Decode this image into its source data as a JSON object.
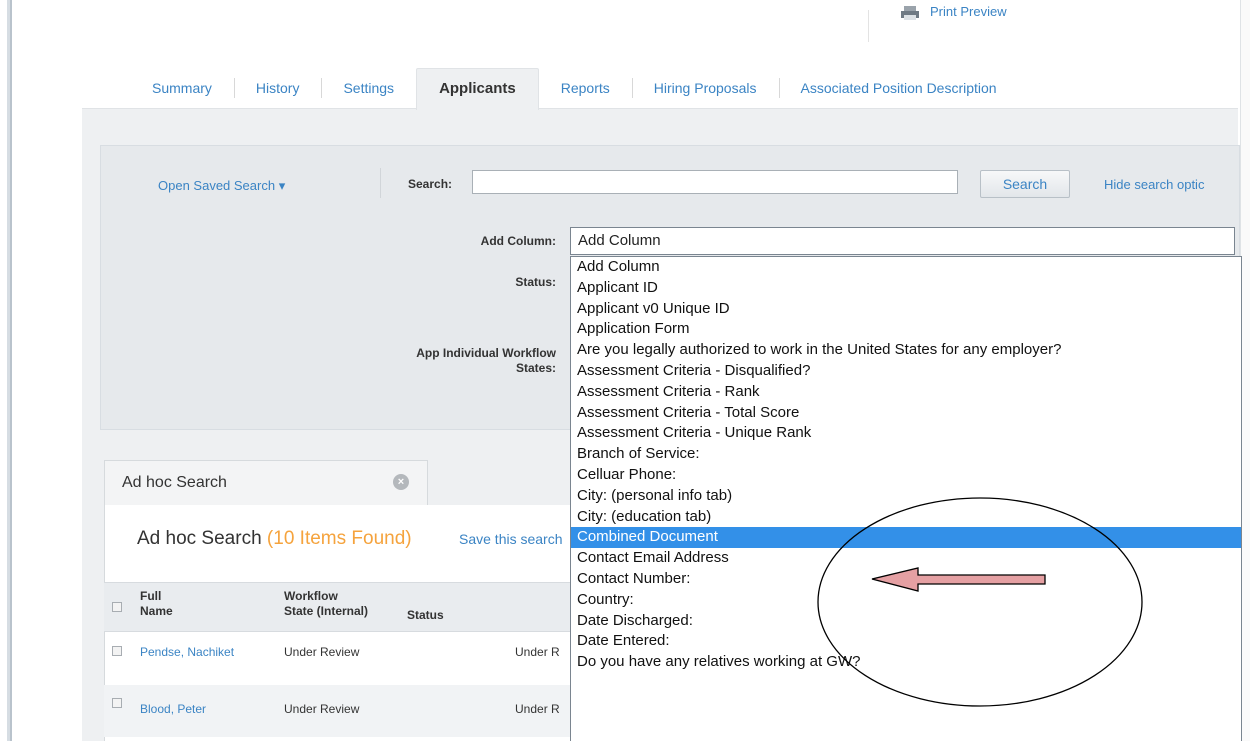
{
  "header": {
    "print_preview": "Print Preview"
  },
  "tabs": [
    {
      "label": "Summary"
    },
    {
      "label": "History"
    },
    {
      "label": "Settings"
    },
    {
      "label": "Applicants",
      "active": true
    },
    {
      "label": "Reports"
    },
    {
      "label": "Hiring Proposals"
    },
    {
      "label": "Associated Position Description"
    }
  ],
  "search": {
    "open_saved_search": "Open Saved Search ▾",
    "search_label": "Search:",
    "search_value": "",
    "search_button": "Search",
    "hide_options": "Hide search optic",
    "add_column_label": "Add Column:",
    "status_label": "Status:",
    "workflow_label_1": "App Individual Workflow",
    "workflow_label_2": "States:"
  },
  "add_column_select": {
    "selected_value": "Add Column",
    "highlighted": "Combined Document",
    "options": [
      "Add Column",
      "Applicant ID",
      "Applicant v0 Unique ID",
      "Application Form",
      "Are you legally authorized to work in the United States for any employer?",
      "Assessment Criteria - Disqualified?",
      "Assessment Criteria - Rank",
      "Assessment Criteria - Total Score",
      "Assessment Criteria - Unique Rank",
      "Branch of Service:",
      "Celluar Phone:",
      "City: (personal info tab)",
      "City: (education tab)",
      "Combined Document",
      "Contact Email Address",
      "Contact Number:",
      "Country:",
      "Date Discharged:",
      "Date Entered:",
      "Do you have any relatives working at GW?"
    ]
  },
  "results": {
    "tab_label": "Ad hoc Search",
    "title": "Ad hoc Search",
    "count_text": "(10 Items Found)",
    "save_link": "Save this search",
    "columns": {
      "full_name_1": "Full",
      "full_name_2": "Name",
      "workflow_1": "Workflow",
      "workflow_2": "State (Internal)",
      "status": "Status"
    },
    "rows": [
      {
        "name": "Pendse, Nachiket",
        "workflow": "Under Review",
        "status": "Under R"
      },
      {
        "name": "Blood, Peter",
        "workflow": "Under Review",
        "status": "Under R"
      }
    ]
  },
  "colors": {
    "link": "#3b84c4",
    "count": "#f5a33d",
    "highlight": "#3390e8",
    "arrow_fill": "#e5a0a3"
  }
}
